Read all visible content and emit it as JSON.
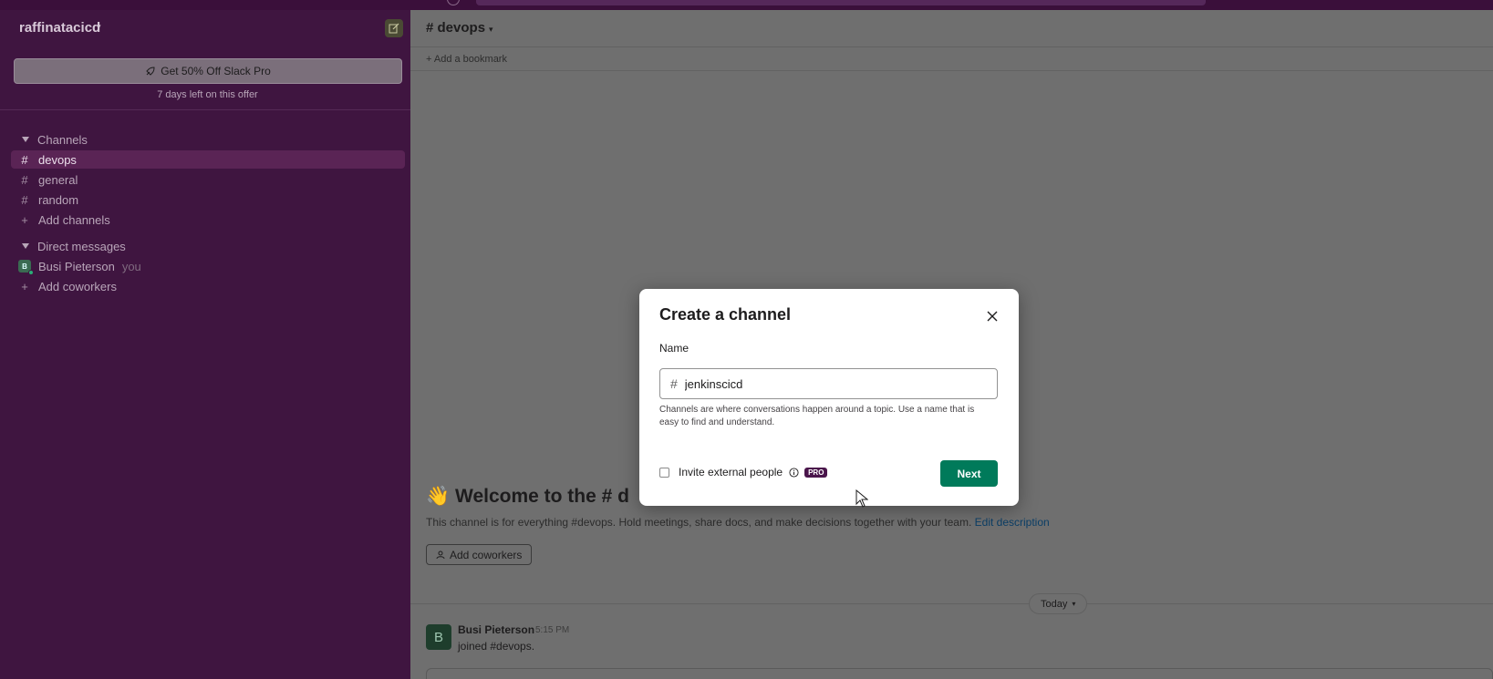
{
  "workspace": {
    "name": "raffinatacicd"
  },
  "promo": {
    "button_label": "Get 50% Off Slack Pro",
    "subtext": "7 days left on this offer"
  },
  "sidebar": {
    "channels_header": "Channels",
    "channels": [
      {
        "name": "devops",
        "active": true
      },
      {
        "name": "general",
        "active": false
      },
      {
        "name": "random",
        "active": false
      }
    ],
    "add_channels": "Add channels",
    "dm_header": "Direct messages",
    "dm_user": {
      "initial": "B",
      "name": "Busi Pieterson",
      "tag": "you"
    },
    "add_coworkers": "Add coworkers"
  },
  "channel": {
    "title": "devops",
    "add_bookmark": "Add a bookmark",
    "welcome_title": "Welcome to the # d",
    "welcome_desc": "This channel is for everything #devops. Hold meetings, share docs, and make decisions together with your team.",
    "edit_description": "Edit description",
    "add_coworkers_btn": "Add coworkers",
    "day_divider": "Today",
    "message": {
      "avatar_initial": "B",
      "author": "Busi Pieterson",
      "time": "5:15 PM",
      "text": "joined #devops."
    }
  },
  "modal": {
    "title": "Create a channel",
    "name_label": "Name",
    "name_value": "jenkinscicd",
    "hint": "Channels are where conversations happen around a topic. Use a name that is easy to find and understand.",
    "invite_external": "Invite external people",
    "pro_badge": "PRO",
    "next_label": "Next"
  },
  "colors": {
    "sidebar_bg": "#3f1540",
    "primary_button": "#007a5a",
    "pro_badge": "#4a154b",
    "link": "#1264a3"
  }
}
